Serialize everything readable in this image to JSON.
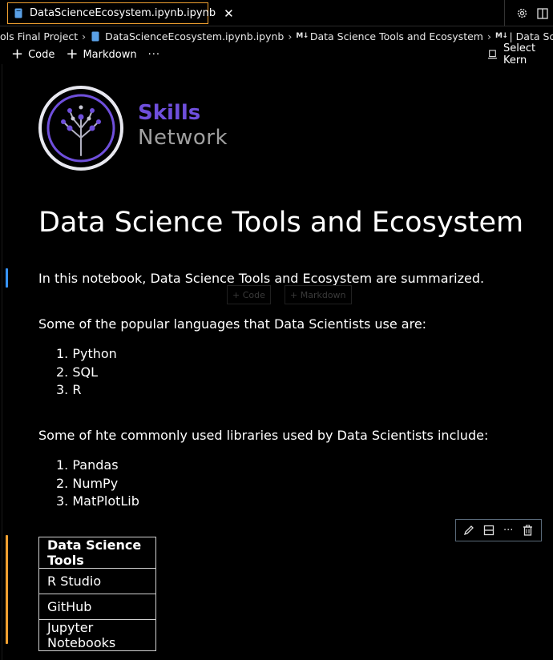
{
  "tab": {
    "label": "DataScienceEcosystem.ipynb.ipynb",
    "close_glyph": "✕",
    "border_color": "#f0a030"
  },
  "breadcrumb": {
    "items": [
      "ols Final Project",
      "DataScienceEcosystem.ipynb.ipynb",
      "Data Science Tools and Ecosystem",
      "| Data Science Too"
    ],
    "markdown_badge": "M↓"
  },
  "toolbar": {
    "code_label": "Code",
    "markdown_label": "Markdown",
    "more_label": "···",
    "kernel_label": "Select Kern"
  },
  "logo": {
    "line1": "Skills",
    "line2": "Network"
  },
  "notebook": {
    "title": "Data Science Tools and Ecosystem",
    "intro": "In this notebook, Data Science Tools and Ecosystem are summarized.",
    "ghost_code": "+ Code",
    "ghost_markdown": "+ Markdown",
    "languages_heading": "Some of the popular languages that Data Scientists use are:",
    "languages": [
      "1. Python",
      "2. SQL",
      "3. R"
    ],
    "libraries_heading": "Some of hte commonly used libraries used by Data Scientists include:",
    "libraries": [
      "1. Pandas",
      "2. NumPy",
      "3. MatPlotLib"
    ],
    "table": {
      "header": "Data Science Tools",
      "rows": [
        "R Studio",
        "GitHub",
        "Jupyter Notebooks"
      ]
    }
  },
  "colors": {
    "accent_blue_indicator": "#3794ff",
    "accent_orange_indicator": "#f0a030",
    "logo_purple": "#6f4fdc",
    "logo_gray": "#a0a0a0"
  },
  "icons": {
    "tab_file": "notebook-file-icon",
    "settings": "gear-icon",
    "split": "split-editor-icon",
    "kernel": "kernel-icon",
    "edit": "pencil-icon",
    "split_cell": "split-cell-icon",
    "more": "more-icon",
    "delete": "trash-icon"
  }
}
